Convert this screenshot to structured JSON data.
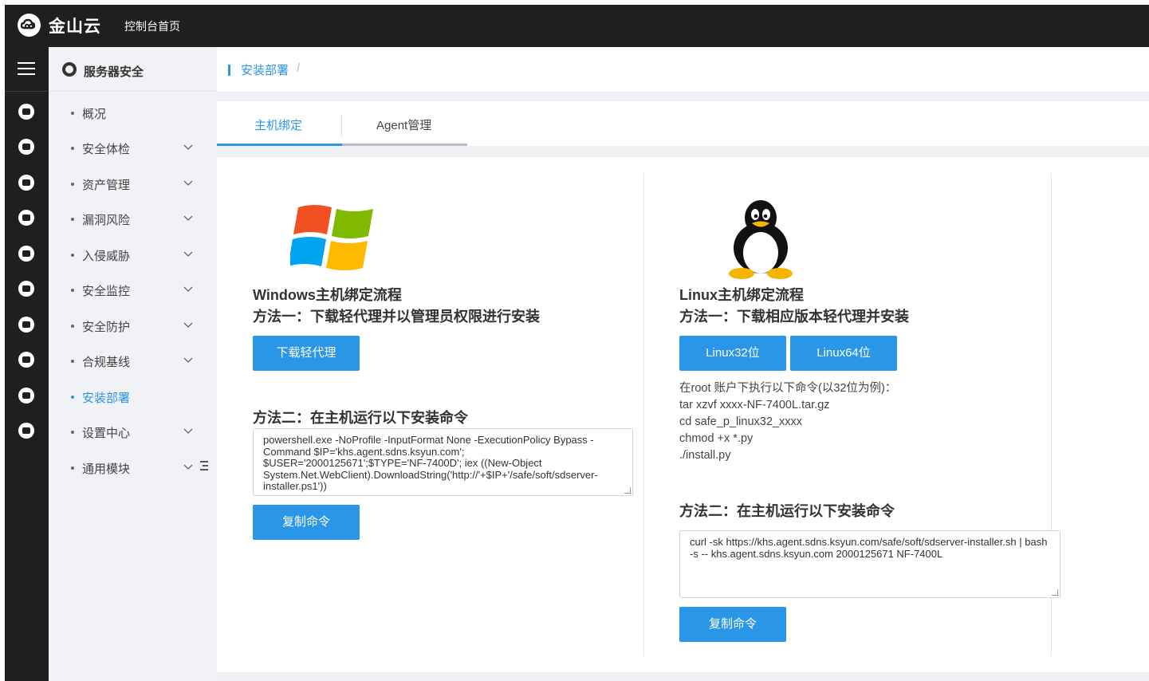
{
  "topbar": {
    "logo_text": "金山云",
    "console_home": "控制台首页"
  },
  "rail": {
    "icons": [
      "menu-icon",
      "security-icon",
      "server-icon",
      "shield-icon",
      "database-icon",
      "network-icon",
      "share-icon",
      "storage-icon",
      "cloud-icon",
      "mail-icon",
      "monitor-icon"
    ]
  },
  "sidebar": {
    "header": "服务器安全",
    "items": [
      {
        "label": "概况",
        "has_chevron": false
      },
      {
        "label": "安全体检",
        "has_chevron": true
      },
      {
        "label": "资产管理",
        "has_chevron": true
      },
      {
        "label": "漏洞风险",
        "has_chevron": true
      },
      {
        "label": "入侵威胁",
        "has_chevron": true
      },
      {
        "label": "安全监控",
        "has_chevron": true
      },
      {
        "label": "安全防护",
        "has_chevron": true
      },
      {
        "label": "合规基线",
        "has_chevron": true
      },
      {
        "label": "安装部署",
        "has_chevron": false,
        "active": true
      },
      {
        "label": "设置中心",
        "has_chevron": true
      },
      {
        "label": "通用模块",
        "has_chevron": true
      }
    ]
  },
  "breadcrumb": {
    "current": "安装部署",
    "separator": "/"
  },
  "tabs": [
    {
      "label": "主机绑定",
      "active": true
    },
    {
      "label": "Agent管理",
      "active": false
    }
  ],
  "windows": {
    "title": "Windows主机绑定流程",
    "method1": "方法一：下载轻代理并以管理员权限进行安装",
    "download_button": "下载轻代理",
    "method2": "方法二：在主机运行以下安装命令",
    "command": "powershell.exe -NoProfile -InputFormat None -ExecutionPolicy Bypass -Command $IP='khs.agent.sdns.ksyun.com'; $USER='2000125671';$TYPE='NF-7400D'; iex ((New-Object System.Net.WebClient).DownloadString('http://'+$IP+'/safe/soft/sdserver-installer.ps1'))",
    "copy_button": "复制命令"
  },
  "linux": {
    "title": "Linux主机绑定流程",
    "method1": "方法一：下载相应版本轻代理并安装",
    "btn32": "Linux32位",
    "btn64": "Linux64位",
    "instructions": [
      "在root 账户下执行以下命令(以32位为例)：",
      "tar xzvf xxxx-NF-7400L.tar.gz",
      "cd safe_p_linux32_xxxx",
      "chmod +x *.py",
      "./install.py"
    ],
    "method2": "方法二：在主机运行以下安装命令",
    "command": "curl -sk https://khs.agent.sdns.ksyun.com/safe/soft/sdserver-installer.sh | bash -s -- khs.agent.sdns.ksyun.com 2000125671 NF-7400L",
    "copy_button": "复制命令"
  },
  "colors": {
    "accent": "#2a96e8",
    "topbar_bg": "#1f1f1f",
    "sidebar_bg": "#f1f2f5"
  }
}
